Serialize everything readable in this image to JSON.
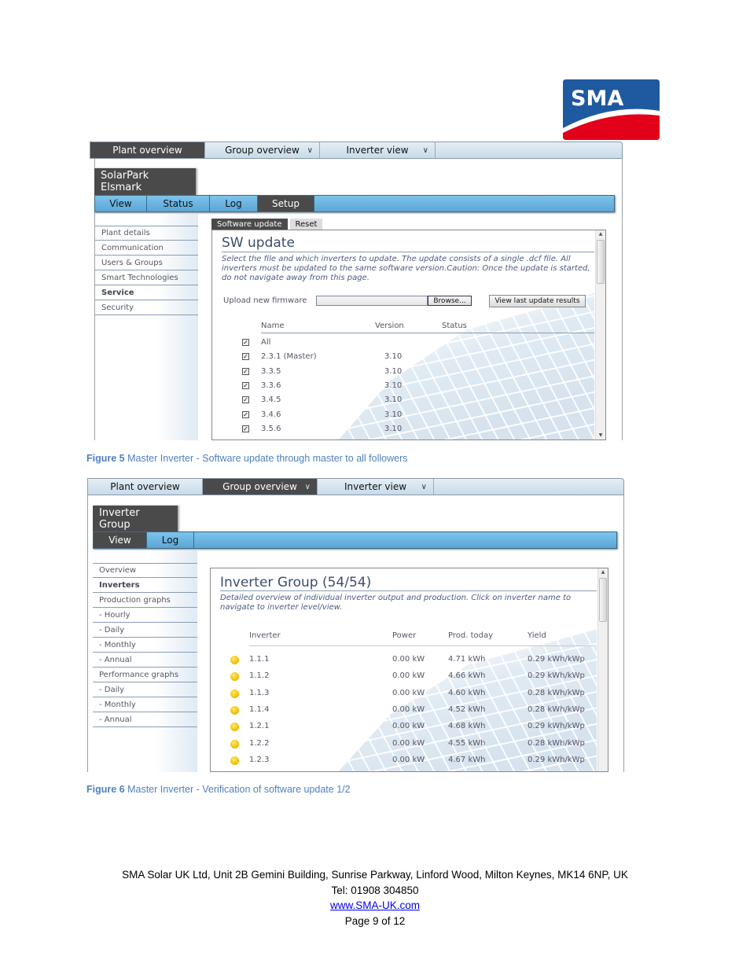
{
  "logo": {
    "text": "SMA",
    "colors": {
      "blue": "#1f5aa0",
      "red": "#e2001a"
    }
  },
  "figure5": {
    "topnav": [
      {
        "label": "Plant overview",
        "active": true,
        "dropdown": false
      },
      {
        "label": "Group overview",
        "active": false,
        "dropdown": true
      },
      {
        "label": "Inverter view",
        "active": false,
        "dropdown": true
      }
    ],
    "chevron": "∨",
    "title_tab": "SolarPark Elsmark",
    "subnav": [
      {
        "label": "View",
        "active": false
      },
      {
        "label": "Status",
        "active": false
      },
      {
        "label": "Log",
        "active": false
      },
      {
        "label": "Setup",
        "active": true
      }
    ],
    "sidebar": [
      {
        "label": "Plant details",
        "bold": false
      },
      {
        "label": "Communication",
        "bold": false
      },
      {
        "label": "Users & Groups",
        "bold": false
      },
      {
        "label": "Smart Technologies",
        "bold": false
      },
      {
        "label": "Service",
        "bold": true
      },
      {
        "label": "Security",
        "bold": false
      }
    ],
    "content_tabs": [
      {
        "label": "Software update",
        "active": true
      },
      {
        "label": "Reset",
        "active": false
      }
    ],
    "heading": "SW update",
    "description": "Select the file and which inverters to update. The update consists of a single .dcf file. All inverters must be updated to the same software version.Caution: Once the update is started, do not navigate away from this page.",
    "upload_label": "Upload new firmware",
    "file_input_value": "",
    "browse_button": "Browse...",
    "view_results_button": "View last update results",
    "table_headers": {
      "name": "Name",
      "version": "Version",
      "status": "Status"
    },
    "rows": [
      {
        "checked": true,
        "name": "All",
        "version": "",
        "status": ""
      },
      {
        "checked": true,
        "name": "2.3.1 (Master)",
        "version": "3.10",
        "status": ""
      },
      {
        "checked": true,
        "name": "3.3.5",
        "version": "3.10",
        "status": ""
      },
      {
        "checked": true,
        "name": "3.3.6",
        "version": "3.10",
        "status": ""
      },
      {
        "checked": true,
        "name": "3.4.5",
        "version": "3.10",
        "status": ""
      },
      {
        "checked": true,
        "name": "3.4.6",
        "version": "3.10",
        "status": ""
      },
      {
        "checked": true,
        "name": "3.5.6",
        "version": "3.10",
        "status": ""
      }
    ],
    "caption_label": "Figure 5",
    "caption_text": " Master Inverter - Software update through master to all followers"
  },
  "figure6": {
    "topnav": [
      {
        "label": "Plant overview",
        "active": false,
        "dropdown": false
      },
      {
        "label": "Group overview",
        "active": true,
        "dropdown": true
      },
      {
        "label": "Inverter view",
        "active": false,
        "dropdown": true
      }
    ],
    "chevron": "∨",
    "title_tab": "Inverter Group",
    "subnav": [
      {
        "label": "View",
        "active": true
      },
      {
        "label": "Log",
        "active": false
      }
    ],
    "sidebar": [
      {
        "label": "Overview",
        "bold": false
      },
      {
        "label": "Inverters",
        "bold": true
      },
      {
        "label": "Production graphs",
        "bold": false
      },
      {
        "label": "- Hourly",
        "bold": false
      },
      {
        "label": "- Daily",
        "bold": false
      },
      {
        "label": "- Monthly",
        "bold": false
      },
      {
        "label": "- Annual",
        "bold": false
      },
      {
        "label": "Performance graphs",
        "bold": false
      },
      {
        "label": "- Daily",
        "bold": false
      },
      {
        "label": "- Monthly",
        "bold": false
      },
      {
        "label": "- Annual",
        "bold": false
      }
    ],
    "heading": "Inverter Group (54/54)",
    "description": "Detailed overview of individual inverter output and production. Click on inverter name to navigate to inverter level/view.",
    "table_headers": {
      "inverter": "Inverter",
      "power": "Power",
      "prod_today": "Prod. today",
      "yield": "Yield"
    },
    "status_color": "#f5c000",
    "rows": [
      {
        "inverter": "1.1.1",
        "power": "0.00 kW",
        "prod_today": "4.71 kWh",
        "yield": "0.29 kWh/kWp"
      },
      {
        "inverter": "1.1.2",
        "power": "0.00 kW",
        "prod_today": "4.66 kWh",
        "yield": "0.29 kWh/kWp"
      },
      {
        "inverter": "1.1.3",
        "power": "0.00 kW",
        "prod_today": "4.60 kWh",
        "yield": "0.28 kWh/kWp"
      },
      {
        "inverter": "1.1.4",
        "power": "0.00 kW",
        "prod_today": "4.52 kWh",
        "yield": "0.28 kWh/kWp"
      },
      {
        "inverter": "1.2.1",
        "power": "0.00 kW",
        "prod_today": "4.68 kWh",
        "yield": "0.29 kWh/kWp"
      },
      {
        "inverter": "1.2.2",
        "power": "0.00 kW",
        "prod_today": "4.55 kWh",
        "yield": "0.28 kWh/kWp"
      },
      {
        "inverter": "1.2.3",
        "power": "0.00 kW",
        "prod_today": "4.67 kWh",
        "yield": "0.29 kWh/kWp"
      }
    ],
    "caption_label": "Figure 6",
    "caption_text": " Master Inverter - Verification of software update 1/2"
  },
  "footer": {
    "address": "SMA Solar UK Ltd, Unit 2B Gemini Building, Sunrise Parkway, Linford Wood, Milton Keynes, MK14 6NP, UK",
    "tel": "Tel: 01908 304850",
    "website": "www.SMA-UK.com",
    "page": "Page 9 of 12"
  }
}
